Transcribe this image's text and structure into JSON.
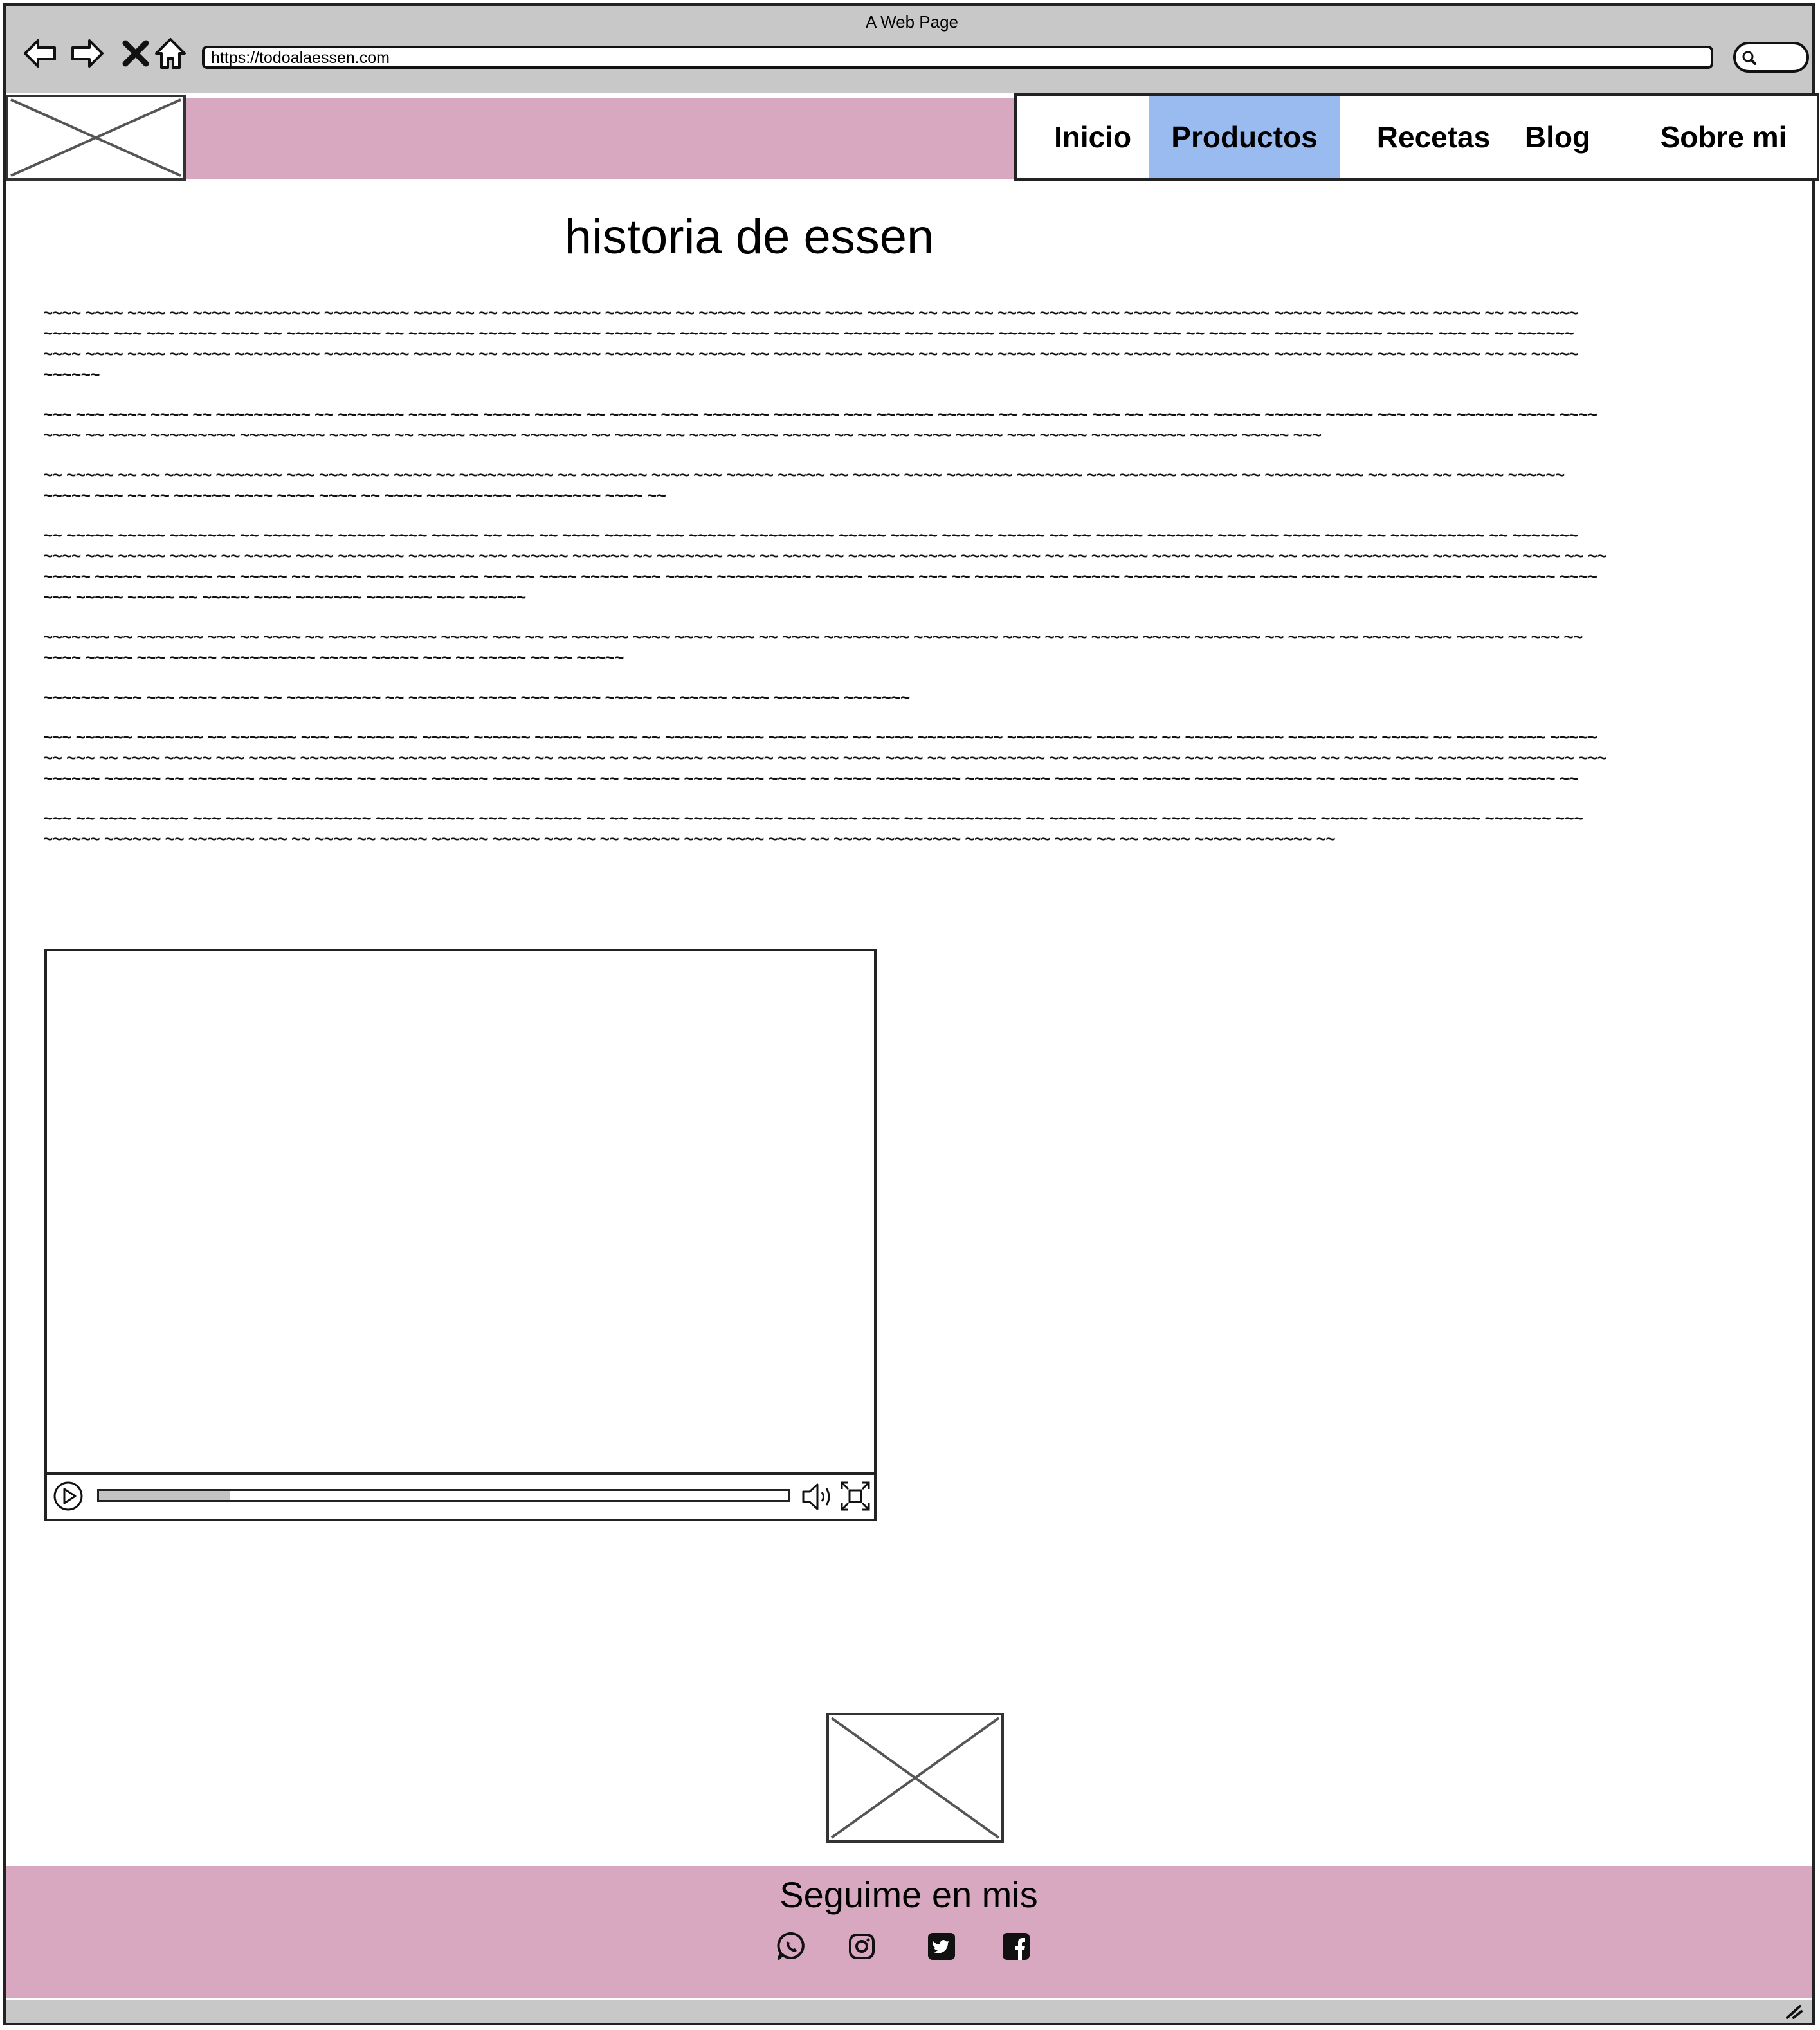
{
  "window": {
    "title": "A Web Page"
  },
  "browser": {
    "url": "https://todoalaessen.com",
    "icons": [
      "back-arrow-icon",
      "forward-arrow-icon",
      "close-x-icon",
      "home-icon",
      "search-icon"
    ]
  },
  "nav": {
    "items": [
      {
        "label": "Inicio",
        "active": false
      },
      {
        "label": "Productos",
        "active": true
      },
      {
        "label": "Recetas",
        "active": false
      },
      {
        "label": "Blog",
        "active": false
      },
      {
        "label": "Sobre mi",
        "active": false
      }
    ]
  },
  "colors": {
    "header_bar": "#d8a7c0",
    "active_tab": "#99bbef",
    "footer": "#d8a7c0",
    "chrome": "#c8c8c8"
  },
  "main": {
    "title": "historia de essen",
    "paragraphs": [
      "~~~~ ~~~~ ~~~~ ~~ ~~~~ ~~~~~~~~~ ~~~~~~~~~ ~~~~ ~~ ~~ ~~~~~ ~~~~~ ~~~~~~~ ~~ ~~~~~ ~~ ~~~~~ ~~~~ ~~~~~ ~~ ~~~ ~~ ~~~~ ~~~~~ ~~~ ~~~~~ ~~~~~~~~~~ ~~~~~ ~~~~~ ~~~ ~~ ~~~~~ ~~ ~~ ~~~~~ ~~~~~~~ ~~~ ~~~ ~~~~ ~~~~ ~~ ~~~~~~~~~~ ~~ ~~~~~~~ ~~~~ ~~~ ~~~~~ ~~~~~ ~~ ~~~~~ ~~~~ ~~~~~~~ ~~~~~~ ~~~ ~~~~~~ ~~~~~~ ~~ ~~~~~~~ ~~~ ~~ ~~~~ ~~ ~~~~~ ~~~~~~ ~~~~~ ~~~ ~~ ~~ ~~~~~~ ~~~~ ~~~~ ~~~~ ~~ ~~~~ ~~~~~~~~~ ~~~~~~~~~ ~~~~ ~~ ~~ ~~~~~ ~~~~~ ~~~~~~~ ~~ ~~~~~ ~~ ~~~~~ ~~~~ ~~~~~ ~~ ~~~ ~~ ~~~~ ~~~~~ ~~~ ~~~~~ ~~~~~~~~~~ ~~~~~ ~~~~~ ~~~ ~~ ~~~~~ ~~ ~~ ~~~~~ ~~~~~~",
      "~~~ ~~~ ~~~~ ~~~~ ~~ ~~~~~~~~~~ ~~ ~~~~~~~ ~~~~ ~~~ ~~~~~ ~~~~~ ~~ ~~~~~ ~~~~ ~~~~~~~ ~~~~~~~ ~~~ ~~~~~~ ~~~~~~ ~~ ~~~~~~~ ~~~ ~~ ~~~~ ~~ ~~~~~ ~~~~~~ ~~~~~ ~~~ ~~ ~~ ~~~~~~ ~~~~ ~~~~ ~~~~ ~~ ~~~~ ~~~~~~~~~ ~~~~~~~~~ ~~~~ ~~ ~~ ~~~~~ ~~~~~ ~~~~~~~ ~~ ~~~~~ ~~ ~~~~~ ~~~~ ~~~~~ ~~ ~~~ ~~ ~~~~ ~~~~~ ~~~ ~~~~~ ~~~~~~~~~~ ~~~~~ ~~~~~ ~~~",
      "~~ ~~~~~ ~~ ~~ ~~~~~ ~~~~~~~ ~~~ ~~~ ~~~~ ~~~~ ~~ ~~~~~~~~~~ ~~ ~~~~~~~ ~~~~ ~~~ ~~~~~ ~~~~~ ~~ ~~~~~ ~~~~ ~~~~~~~ ~~~~~~~ ~~~ ~~~~~~ ~~~~~~ ~~ ~~~~~~~ ~~~ ~~ ~~~~ ~~ ~~~~~ ~~~~~~ ~~~~~ ~~~ ~~ ~~ ~~~~~~ ~~~~ ~~~~ ~~~~ ~~ ~~~~ ~~~~~~~~~ ~~~~~~~~~ ~~~~ ~~",
      "~~ ~~~~~ ~~~~~ ~~~~~~~ ~~ ~~~~~ ~~ ~~~~~ ~~~~ ~~~~~ ~~ ~~~ ~~ ~~~~ ~~~~~ ~~~ ~~~~~ ~~~~~~~~~~ ~~~~~ ~~~~~ ~~~ ~~ ~~~~~ ~~ ~~ ~~~~~ ~~~~~~~ ~~~ ~~~ ~~~~ ~~~~ ~~ ~~~~~~~~~~ ~~ ~~~~~~~ ~~~~ ~~~ ~~~~~ ~~~~~ ~~ ~~~~~ ~~~~ ~~~~~~~ ~~~~~~~ ~~~ ~~~~~~ ~~~~~~ ~~ ~~~~~~~ ~~~ ~~ ~~~~ ~~ ~~~~~ ~~~~~~ ~~~~~ ~~~ ~~ ~~ ~~~~~~ ~~~~ ~~~~ ~~~~ ~~ ~~~~ ~~~~~~~~~ ~~~~~~~~~ ~~~~ ~~ ~~ ~~~~~ ~~~~~ ~~~~~~~ ~~ ~~~~~ ~~ ~~~~~ ~~~~ ~~~~~ ~~ ~~~ ~~ ~~~~ ~~~~~ ~~~ ~~~~~ ~~~~~~~~~~ ~~~~~ ~~~~~ ~~~ ~~ ~~~~~ ~~ ~~ ~~~~~ ~~~~~~~ ~~~ ~~~ ~~~~ ~~~~ ~~ ~~~~~~~~~~ ~~ ~~~~~~~ ~~~~ ~~~ ~~~~~ ~~~~~ ~~ ~~~~~ ~~~~ ~~~~~~~ ~~~~~~~ ~~~ ~~~~~~",
      "~~~~~~~ ~~ ~~~~~~~ ~~~ ~~ ~~~~ ~~ ~~~~~ ~~~~~~ ~~~~~ ~~~ ~~ ~~ ~~~~~~ ~~~~ ~~~~ ~~~~ ~~ ~~~~ ~~~~~~~~~ ~~~~~~~~~ ~~~~ ~~ ~~ ~~~~~ ~~~~~ ~~~~~~~ ~~ ~~~~~ ~~ ~~~~~ ~~~~ ~~~~~ ~~ ~~~ ~~ ~~~~ ~~~~~ ~~~ ~~~~~ ~~~~~~~~~~ ~~~~~ ~~~~~ ~~~ ~~ ~~~~~ ~~ ~~ ~~~~~",
      "~~~~~~~ ~~~ ~~~ ~~~~ ~~~~ ~~ ~~~~~~~~~~ ~~ ~~~~~~~ ~~~~ ~~~ ~~~~~ ~~~~~ ~~ ~~~~~ ~~~~ ~~~~~~~ ~~~~~~~",
      "~~~ ~~~~~~ ~~~~~~~ ~~ ~~~~~~~ ~~~ ~~ ~~~~ ~~ ~~~~~ ~~~~~~ ~~~~~ ~~~ ~~ ~~ ~~~~~~ ~~~~ ~~~~ ~~~~ ~~ ~~~~ ~~~~~~~~~ ~~~~~~~~~ ~~~~ ~~ ~~ ~~~~~ ~~~~~ ~~~~~~~ ~~ ~~~~~ ~~ ~~~~~ ~~~~ ~~~~~ ~~ ~~~ ~~ ~~~~ ~~~~~ ~~~ ~~~~~ ~~~~~~~~~~ ~~~~~ ~~~~~ ~~~ ~~ ~~~~~ ~~ ~~ ~~~~~ ~~~~~~~ ~~~ ~~~ ~~~~ ~~~~ ~~ ~~~~~~~~~~ ~~ ~~~~~~~ ~~~~ ~~~ ~~~~~ ~~~~~ ~~ ~~~~~ ~~~~ ~~~~~~~ ~~~~~~~ ~~~ ~~~~~~ ~~~~~~ ~~ ~~~~~~~ ~~~ ~~ ~~~~ ~~ ~~~~~ ~~~~~~ ~~~~~ ~~~ ~~ ~~ ~~~~~~ ~~~~ ~~~~ ~~~~ ~~ ~~~~ ~~~~~~~~~ ~~~~~~~~~ ~~~~ ~~ ~~ ~~~~~ ~~~~~ ~~~~~~~ ~~ ~~~~~ ~~ ~~~~~ ~~~~ ~~~~~ ~~",
      "~~~ ~~ ~~~~ ~~~~~ ~~~ ~~~~~ ~~~~~~~~~~ ~~~~~ ~~~~~ ~~~ ~~ ~~~~~ ~~ ~~ ~~~~~ ~~~~~~~ ~~~ ~~~ ~~~~ ~~~~ ~~ ~~~~~~~~~~ ~~ ~~~~~~~ ~~~~ ~~~ ~~~~~ ~~~~~ ~~ ~~~~~ ~~~~ ~~~~~~~ ~~~~~~~ ~~~ ~~~~~~ ~~~~~~ ~~ ~~~~~~~ ~~~ ~~ ~~~~ ~~ ~~~~~ ~~~~~~ ~~~~~ ~~~ ~~ ~~ ~~~~~~ ~~~~ ~~~~ ~~~~ ~~ ~~~~ ~~~~~~~~~ ~~~~~~~~~ ~~~~ ~~ ~~ ~~~~~ ~~~~~ ~~~~~~~ ~~"
    ]
  },
  "video": {
    "progress": 0.19,
    "controls": [
      "play-icon",
      "volume-icon",
      "fullscreen-icon"
    ]
  },
  "footer": {
    "text": "Seguime en mis",
    "social": [
      "whatsapp-icon",
      "instagram-icon",
      "twitter-icon",
      "facebook-icon"
    ]
  }
}
